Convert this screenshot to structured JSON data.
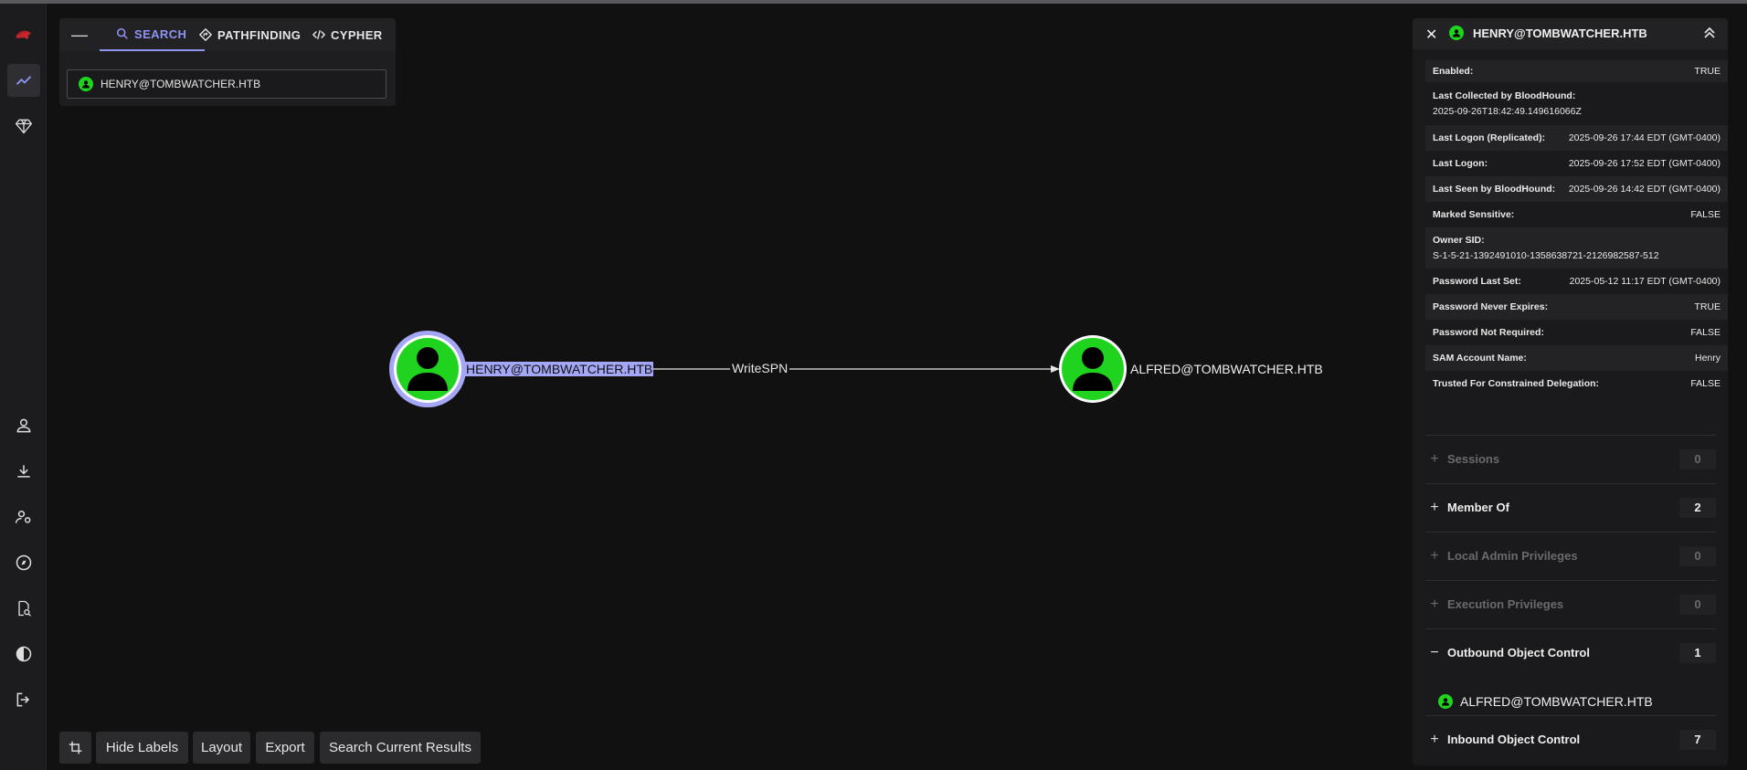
{
  "left_rail": {
    "icons": [
      "bloodhound-logo-icon",
      "explore-icon",
      "gem-icon",
      "user-icon",
      "download-icon",
      "admin-settings-icon",
      "compass-icon",
      "search-file-icon",
      "contrast-icon",
      "logout-icon"
    ]
  },
  "search_panel": {
    "collapse_glyph": "—",
    "tabs": [
      {
        "label": "SEARCH",
        "active": true
      },
      {
        "label": "PATHFINDING",
        "active": false
      },
      {
        "label": "CYPHER",
        "active": false
      }
    ],
    "search_value": "HENRY@TOMBWATCHER.HTB"
  },
  "graph": {
    "source": {
      "label": "HENRY@TOMBWATCHER.HTB",
      "selected": true
    },
    "target": {
      "label": "ALFRED@TOMBWATCHER.HTB",
      "selected": false
    },
    "edge_label": "WriteSPN",
    "node_color": "#1fd31f",
    "selection_color": "#a4a7f5"
  },
  "toolbar": {
    "crop_icon": "crop-icon",
    "hide_labels": "Hide Labels",
    "layout": "Layout",
    "export": "Export",
    "search_current": "Search Current Results"
  },
  "entity_panel": {
    "close_glyph": "✕",
    "name": "HENRY@TOMBWATCHER.HTB",
    "properties": [
      {
        "key": "Enabled:",
        "value": "TRUE"
      },
      {
        "key": "Last Collected by BloodHound:",
        "value": "2025-09-26T18:42:49.149616066Z"
      },
      {
        "key": "Last Logon (Replicated):",
        "value": "2025-09-26 17:44 EDT (GMT-0400)"
      },
      {
        "key": "Last Logon:",
        "value": "2025-09-26 17:52 EDT (GMT-0400)"
      },
      {
        "key": "Last Seen by BloodHound:",
        "value": "2025-09-26 14:42 EDT (GMT-0400)"
      },
      {
        "key": "Marked Sensitive:",
        "value": "FALSE"
      },
      {
        "key": "Owner SID:",
        "value": "S-1-5-21-1392491010-1358638721-2126982587-512"
      },
      {
        "key": "Password Last Set:",
        "value": "2025-05-12 11:17 EDT (GMT-0400)"
      },
      {
        "key": "Password Never Expires:",
        "value": "TRUE"
      },
      {
        "key": "Password Not Required:",
        "value": "FALSE"
      },
      {
        "key": "SAM Account Name:",
        "value": "Henry"
      },
      {
        "key": "Trusted For Constrained Delegation:",
        "value": "FALSE"
      }
    ],
    "sections": [
      {
        "sign": "+",
        "title": "Sessions",
        "count": "0",
        "dim": true
      },
      {
        "sign": "+",
        "title": "Member Of",
        "count": "2",
        "dim": false
      },
      {
        "sign": "+",
        "title": "Local Admin Privileges",
        "count": "0",
        "dim": true
      },
      {
        "sign": "+",
        "title": "Execution Privileges",
        "count": "0",
        "dim": true
      },
      {
        "sign": "−",
        "title": "Outbound Object Control",
        "count": "1",
        "dim": false
      },
      {
        "sign": "+",
        "title": "Inbound Object Control",
        "count": "7",
        "dim": false
      }
    ],
    "outbound_item": "ALFRED@TOMBWATCHER.HTB"
  }
}
